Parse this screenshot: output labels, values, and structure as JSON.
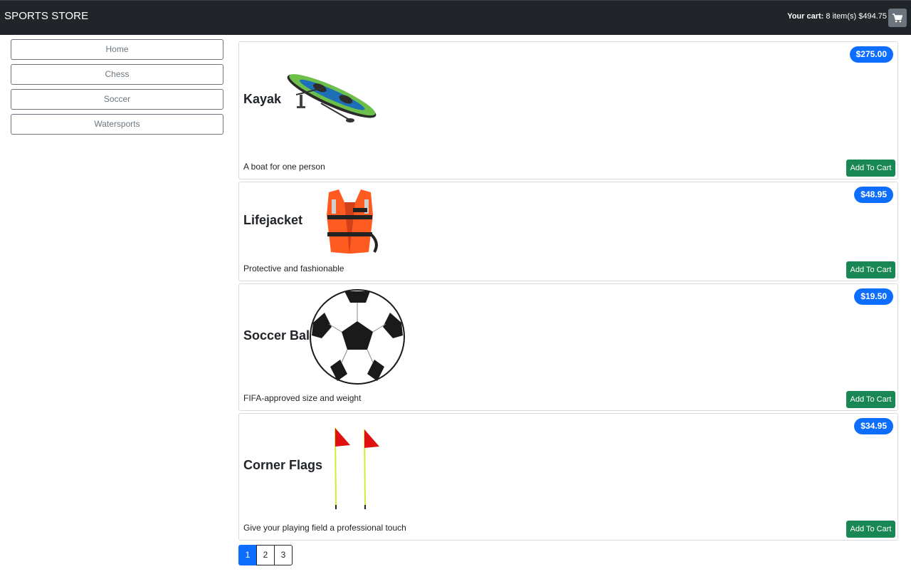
{
  "brand": "SPORTS STORE",
  "cart": {
    "label": "Your cart:",
    "summary": "8 item(s) $494.75",
    "icon": "cart-icon"
  },
  "categories": [
    {
      "label": "Home"
    },
    {
      "label": "Chess"
    },
    {
      "label": "Soccer"
    },
    {
      "label": "Watersports"
    }
  ],
  "products": [
    {
      "name": "Kayak",
      "price": "$275.00",
      "description": "A boat for one person",
      "button": "Add To Cart",
      "image": "kayak-image"
    },
    {
      "name": "Lifejacket",
      "price": "$48.95",
      "description": "Protective and fashionable",
      "button": "Add To Cart",
      "image": "lifejacket-image"
    },
    {
      "name": "Soccer Ball",
      "price": "$19.50",
      "description": "FIFA-approved size and weight",
      "button": "Add To Cart",
      "image": "soccer-ball-image"
    },
    {
      "name": "Corner Flags",
      "price": "$34.95",
      "description": "Give your playing field a professional touch",
      "button": "Add To Cart",
      "image": "corner-flags-image"
    }
  ],
  "pagination": {
    "pages": [
      "1",
      "2",
      "3"
    ],
    "current": "1"
  },
  "colors": {
    "navbar": "#212529",
    "price_badge": "#0d6efd",
    "add_button": "#198754",
    "cart_button": "#6c757d"
  }
}
